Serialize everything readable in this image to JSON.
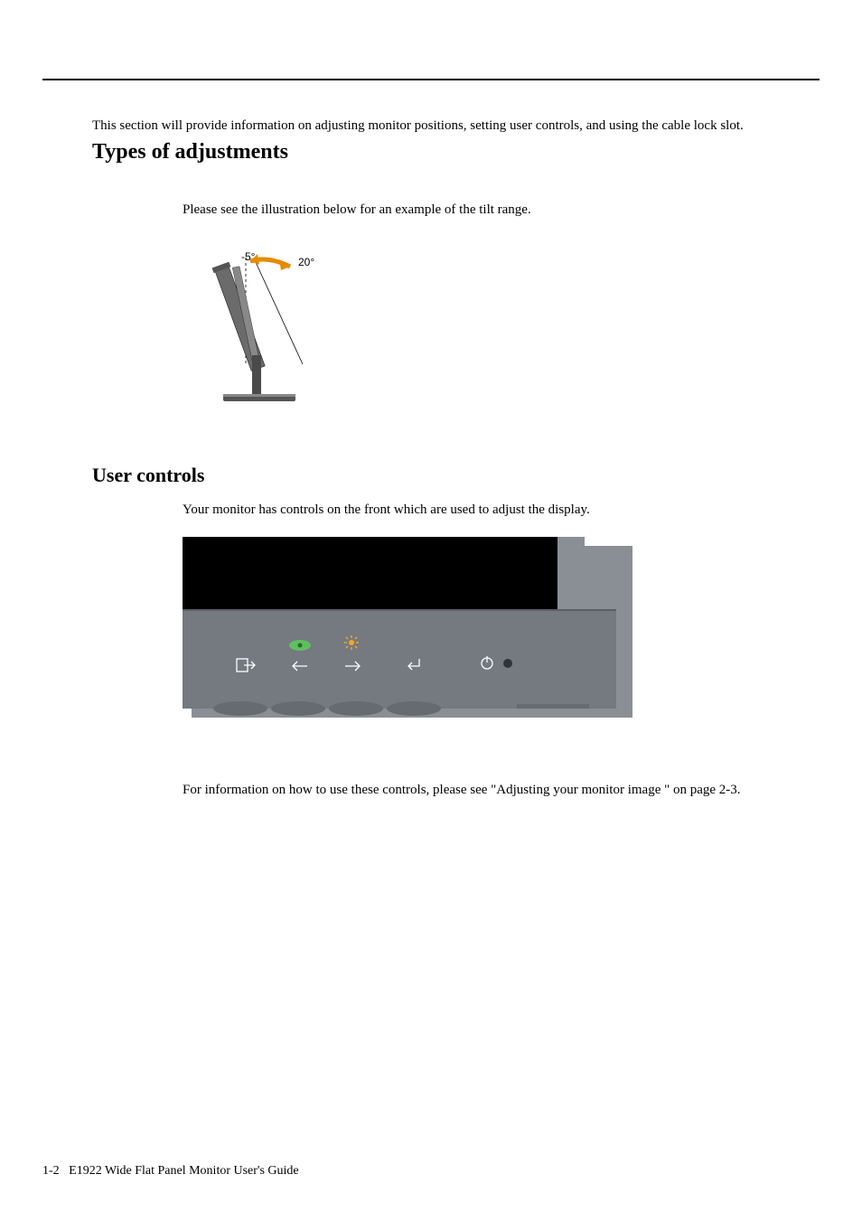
{
  "intro_text": "This section will provide information on adjusting monitor positions, setting user controls, and using the cable lock slot.",
  "headings": {
    "types_of_adjustments": "Types of adjustments",
    "user_controls": "User controls"
  },
  "tilt": {
    "caption": "Please see the illustration below for an example of the tilt range.",
    "label_back": "-5°",
    "label_forward": "20°"
  },
  "user_controls": {
    "caption": "Your monitor has controls on the front which are used to adjust the display.",
    "footer_ref": "For information on how to use these controls, please see \"Adjusting your monitor image \" on page 2-3."
  },
  "controls": {
    "icons": {
      "exit": "exit-icon",
      "novo_vision": "novo-vision-icon",
      "brightness": "brightness-icon",
      "arrow_left": "arrow-left-icon",
      "arrow_right": "arrow-right-icon",
      "enter": "enter-icon",
      "power": "power-icon",
      "led": "power-led"
    }
  },
  "footer": {
    "page_num": "1-2",
    "doc_title": "E1922 Wide Flat Panel Monitor User's Guide"
  }
}
